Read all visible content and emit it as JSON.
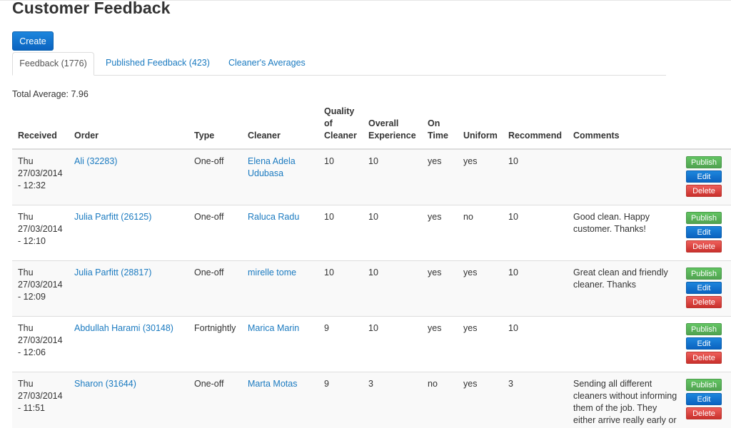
{
  "page": {
    "title": "Customer Feedback",
    "create_label": "Create",
    "total_average": "Total Average: 7.96"
  },
  "tabs": [
    {
      "label": "Feedback (1776)",
      "active": true
    },
    {
      "label": "Published Feedback (423)",
      "active": false
    },
    {
      "label": "Cleaner's Averages",
      "active": false
    }
  ],
  "table": {
    "headers": {
      "received": "Received",
      "order": "Order",
      "type": "Type",
      "cleaner": "Cleaner",
      "quality": "Quality of Cleaner",
      "overall": "Overall Experience",
      "ontime": "On Time",
      "uniform": "Uniform",
      "recommend": "Recommend",
      "comments": "Comments"
    },
    "actions": {
      "publish": "Publish",
      "edit": "Edit",
      "delete": "Delete"
    },
    "rows": [
      {
        "received": "Thu 27/03/2014 - 12:32",
        "order": "Ali (32283)",
        "type": "One-off",
        "cleaner": "Elena Adela Udubasa",
        "quality": "10",
        "overall": "10",
        "ontime": "yes",
        "uniform": "yes",
        "recommend": "10",
        "comments": ""
      },
      {
        "received": "Thu 27/03/2014 - 12:10",
        "order": "Julia Parfitt (26125)",
        "type": "One-off",
        "cleaner": "Raluca Radu",
        "quality": "10",
        "overall": "10",
        "ontime": "yes",
        "uniform": "no",
        "recommend": "10",
        "comments": "Good clean. Happy customer. Thanks!"
      },
      {
        "received": "Thu 27/03/2014 - 12:09",
        "order": "Julia Parfitt (28817)",
        "type": "One-off",
        "cleaner": "mirelle tome",
        "quality": "10",
        "overall": "10",
        "ontime": "yes",
        "uniform": "yes",
        "recommend": "10",
        "comments": "Great clean and friendly cleaner. Thanks"
      },
      {
        "received": "Thu 27/03/2014 - 12:06",
        "order": "Abdullah Harami (30148)",
        "type": "Fortnightly",
        "cleaner": "Marica Marin",
        "quality": "9",
        "overall": "10",
        "ontime": "yes",
        "uniform": "yes",
        "recommend": "10",
        "comments": ""
      },
      {
        "received": "Thu 27/03/2014 - 11:51",
        "order": "Sharon (31644)",
        "type": "One-off",
        "cleaner": "Marta Motas",
        "quality": "9",
        "overall": "3",
        "ontime": "no",
        "uniform": "yes",
        "recommend": "3",
        "comments": "Sending all different cleaners without informing them of the job. They either arrive really early or really late. They throw"
      }
    ]
  },
  "colors": {
    "link": "#1a7ac0",
    "primary": "#0b63c0",
    "success": "#51a351",
    "danger": "#c9302c"
  }
}
